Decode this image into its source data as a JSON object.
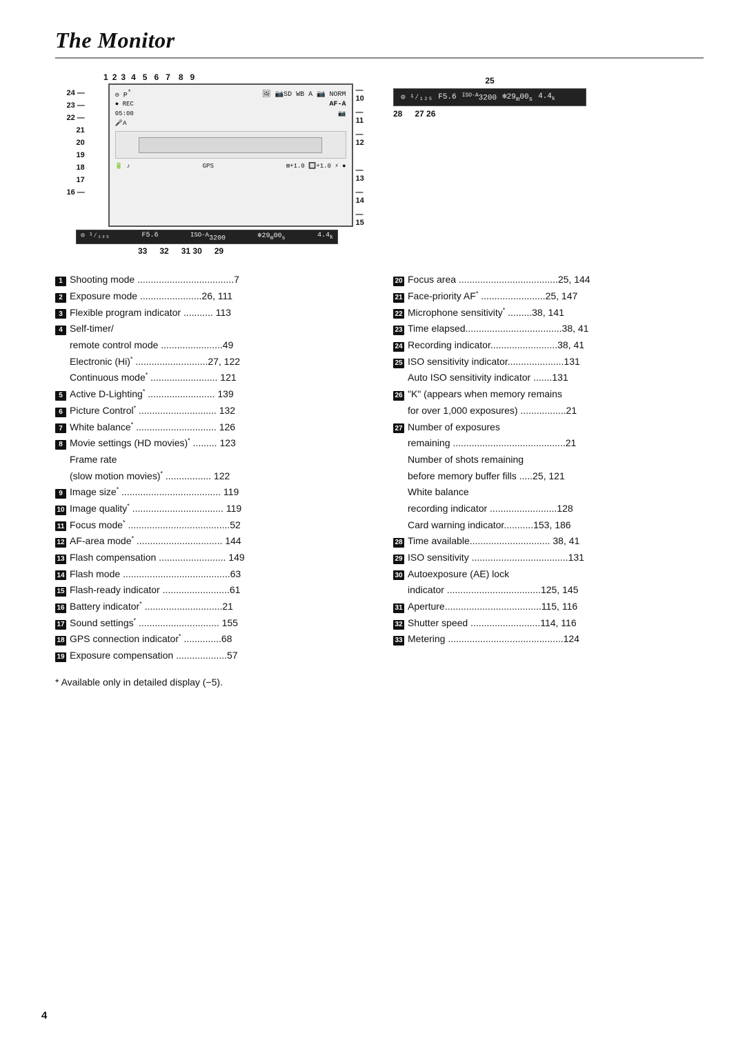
{
  "page": {
    "title": "The Monitor",
    "page_number": "4"
  },
  "diagram": {
    "top_numbers": [
      "1",
      "2",
      "3",
      "4",
      "5",
      "6",
      "7",
      "8",
      "9"
    ],
    "right_numbers": [
      "10",
      "11",
      "12"
    ],
    "left_numbers": [
      "24",
      "23",
      "22",
      "21",
      "20",
      "19",
      "18",
      "17",
      "16"
    ],
    "right_side_numbers": [
      "13",
      "14",
      "15"
    ],
    "screen_content_top": "⊙  P*    🔷  📷SD WB A 📷₇₂ 📷 NORM",
    "screen_content_rec": "● REC                         AF-A",
    "screen_content_time": "05:00                         📷",
    "screen_content_mic": "🎤A",
    "status_bar_left": "⊙ ¹⁄₁₂₅  F5.6 ISO-A 3200  ❄29ₘ00ₛ   4.4ₖ",
    "secondary_screen": "⊙ ¹⁄₁₂₅  F5.6 ISO-A 3200  ❄29ₘ00ₛ   4.4ₖ",
    "bottom_numbers_left": [
      "33",
      "32",
      "31",
      "30",
      "29"
    ],
    "bottom_numbers_right": [
      "28",
      "27",
      "26"
    ],
    "label_25": "25"
  },
  "left_column": [
    {
      "num": "1",
      "text": "Shooting mode",
      "dots": true,
      "page": "7"
    },
    {
      "num": "2",
      "text": "Exposure mode",
      "dots": true,
      "page": "26, 111"
    },
    {
      "num": "3",
      "text": "Flexible program indicator",
      "dots": true,
      "page": "113"
    },
    {
      "num": "4",
      "text": "Self-timer/",
      "sub": [
        {
          "text": "remote control mode",
          "dots": true,
          "page": "49"
        },
        {
          "text": "Electronic (Hi)*",
          "dots": true,
          "page": "27, 122"
        },
        {
          "text": "Continuous mode*",
          "dots": true,
          "page": "121"
        }
      ]
    },
    {
      "num": "5",
      "text": "Active D-Lighting*",
      "dots": true,
      "page": "139"
    },
    {
      "num": "6",
      "text": "Picture Control*",
      "dots": true,
      "page": "132"
    },
    {
      "num": "7",
      "text": "White balance*",
      "dots": true,
      "page": "126"
    },
    {
      "num": "8",
      "text": "Movie settings (HD movies)*",
      "dots": true,
      "page": "123",
      "sub": [
        {
          "text": "Frame rate",
          "dots": false,
          "page": ""
        },
        {
          "text": "(slow motion movies)*",
          "dots": true,
          "page": "122"
        }
      ]
    },
    {
      "num": "9",
      "text": "Image size*",
      "dots": true,
      "page": "119"
    },
    {
      "num": "10",
      "text": "Image quality*",
      "dots": true,
      "page": "119"
    },
    {
      "num": "11",
      "text": "Focus mode*",
      "dots": true,
      "page": "52"
    },
    {
      "num": "12",
      "text": "AF-area mode*",
      "dots": true,
      "page": "144"
    },
    {
      "num": "13",
      "text": "Flash compensation",
      "dots": true,
      "page": "149"
    },
    {
      "num": "14",
      "text": "Flash mode",
      "dots": true,
      "page": "63"
    },
    {
      "num": "15",
      "text": "Flash-ready indicator",
      "dots": true,
      "page": "61"
    },
    {
      "num": "16",
      "text": "Battery indicator*",
      "dots": true,
      "page": "21"
    },
    {
      "num": "17",
      "text": "Sound settings*",
      "dots": true,
      "page": "155"
    },
    {
      "num": "18",
      "text": "GPS connection indicator*",
      "dots": true,
      "page": "68"
    },
    {
      "num": "19",
      "text": "Exposure compensation",
      "dots": true,
      "page": "57"
    }
  ],
  "right_column": [
    {
      "num": "20",
      "text": "Focus area",
      "dots": true,
      "page": "25, 144"
    },
    {
      "num": "21",
      "text": "Face-priority AF*",
      "dots": true,
      "page": "25, 147"
    },
    {
      "num": "22",
      "text": "Microphone sensitivity*",
      "dots": true,
      "page": "38, 141"
    },
    {
      "num": "23",
      "text": "Time elapsed",
      "dots": true,
      "page": "38, 41"
    },
    {
      "num": "24",
      "text": "Recording indicator",
      "dots": true,
      "page": "38, 41"
    },
    {
      "num": "25",
      "text": "ISO sensitivity indicator",
      "dots": true,
      "page": "131",
      "sub": [
        {
          "text": "Auto ISO sensitivity indicator",
          "dots": true,
          "page": "131"
        }
      ]
    },
    {
      "num": "26",
      "text": "“K” (appears when memory remains",
      "sub": [
        {
          "text": "for over 1,000 exposures)",
          "dots": true,
          "page": "21"
        }
      ]
    },
    {
      "num": "27",
      "text": "Number of exposures",
      "sub": [
        {
          "text": "remaining",
          "dots": true,
          "page": "21"
        },
        {
          "text": "Number of shots remaining",
          "dots": false,
          "page": ""
        },
        {
          "text": "before memory buffer fills",
          "dots": true,
          "page": "25, 121"
        },
        {
          "text": "White balance",
          "dots": false,
          "page": ""
        },
        {
          "text": "recording indicator",
          "dots": true,
          "page": "128"
        },
        {
          "text": "Card warning indicator",
          "dots": true,
          "page": "153, 186"
        }
      ]
    },
    {
      "num": "28",
      "text": "Time available",
      "dots": true,
      "page": "38, 41"
    },
    {
      "num": "29",
      "text": "ISO sensitivity",
      "dots": true,
      "page": "131"
    },
    {
      "num": "30",
      "text": "Autoexposure (AE) lock",
      "sub": [
        {
          "text": "indicator",
          "dots": true,
          "page": "125, 145"
        }
      ]
    },
    {
      "num": "31",
      "text": "Aperture",
      "dots": true,
      "page": "115, 116"
    },
    {
      "num": "32",
      "text": "Shutter speed",
      "dots": true,
      "page": "114, 116"
    },
    {
      "num": "33",
      "text": "Metering",
      "dots": true,
      "page": "124"
    }
  ],
  "footnote": "* Available only in detailed display (−5)."
}
